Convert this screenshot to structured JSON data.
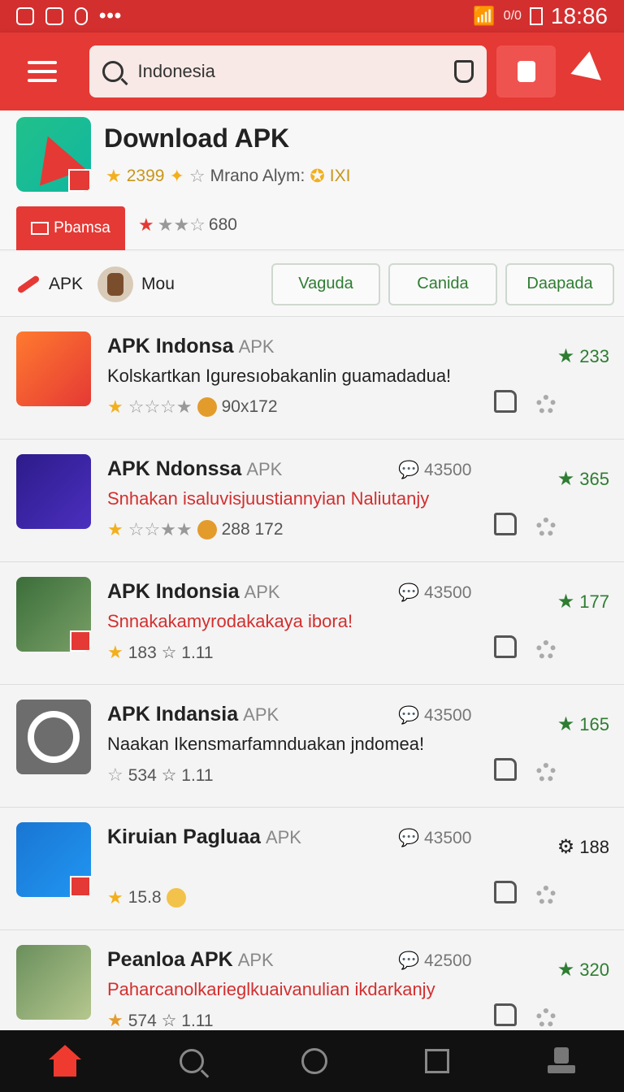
{
  "status": {
    "time": "18:86",
    "small": "0/0"
  },
  "search": {
    "value": "Indonesia"
  },
  "hero": {
    "title": "Download APK",
    "rating": "2399",
    "meta": "Mrano Alym:",
    "badge": "Pbamsa",
    "rating_count": "680",
    "icon_text": "IXI"
  },
  "filters": {
    "cat1": "APK",
    "cat2": "Mou",
    "chips": [
      "Vaguda",
      "Canida",
      "Daapada"
    ]
  },
  "apps": [
    {
      "title": "APK Indonsa",
      "tag": "APK",
      "comments": "",
      "desc": "Kolskartkan Iguresıobakanlin guamadadua!",
      "desc_red": false,
      "rating": "90x172",
      "score": "233"
    },
    {
      "title": "APK Ndonssa",
      "tag": "APK",
      "comments": "43500",
      "desc": "Snhakan isaluvisjuustiannyian Naliutanjy",
      "desc_red": true,
      "rating": "288 172",
      "score": "365"
    },
    {
      "title": "APK Indonsia",
      "tag": "APK",
      "comments": "43500",
      "desc": "Snnakakamyrodakakaya ibora!",
      "desc_red": true,
      "rating": "183 ☆ 1.11",
      "score": "177"
    },
    {
      "title": "APK Indansia",
      "tag": "APK",
      "comments": "43500",
      "desc": "Naakan Ikensmarfamnduakan jndomea!",
      "desc_red": false,
      "rating": "534 ☆ 1.11",
      "score": "165"
    },
    {
      "title": "Kiruian Pagluaa",
      "tag": "APK",
      "comments": "43500",
      "desc": "",
      "desc_red": false,
      "rating": "15.8",
      "score": "188"
    },
    {
      "title": "Peanloa APK",
      "tag": "APK",
      "comments": "42500",
      "desc": "Paharcanolkarieglkuaivanulian ikdarkanjy",
      "desc_red": true,
      "rating": "574 ☆ 1.11",
      "score": "320"
    }
  ]
}
